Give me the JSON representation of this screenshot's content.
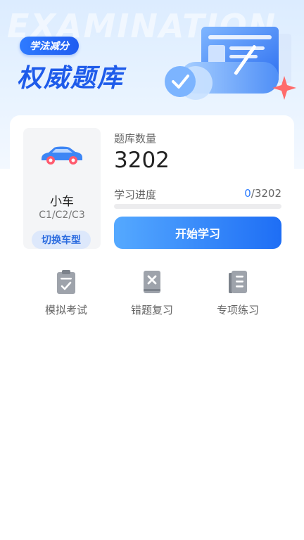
{
  "hero": {
    "watermark": "EXAMINATION",
    "badge": "学法减分",
    "title": "权威题库"
  },
  "car": {
    "name": "小车",
    "types": "C1/C2/C3",
    "switch_label": "切换车型"
  },
  "question_bank": {
    "label": "题库数量",
    "count": "3202"
  },
  "progress": {
    "label": "学习进度",
    "current": "0",
    "separator": "/",
    "total": "3202",
    "fraction": 0
  },
  "start_button": "开始学习",
  "entries": [
    {
      "icon": "clipboard-check-icon",
      "label": "模拟考试"
    },
    {
      "icon": "wrong-book-icon",
      "label": "错题复习"
    },
    {
      "icon": "list-book-icon",
      "label": "专项练习"
    }
  ],
  "colors": {
    "accent": "#1e6ef5",
    "title": "#1e5bea",
    "progress": "#3a86ff"
  }
}
